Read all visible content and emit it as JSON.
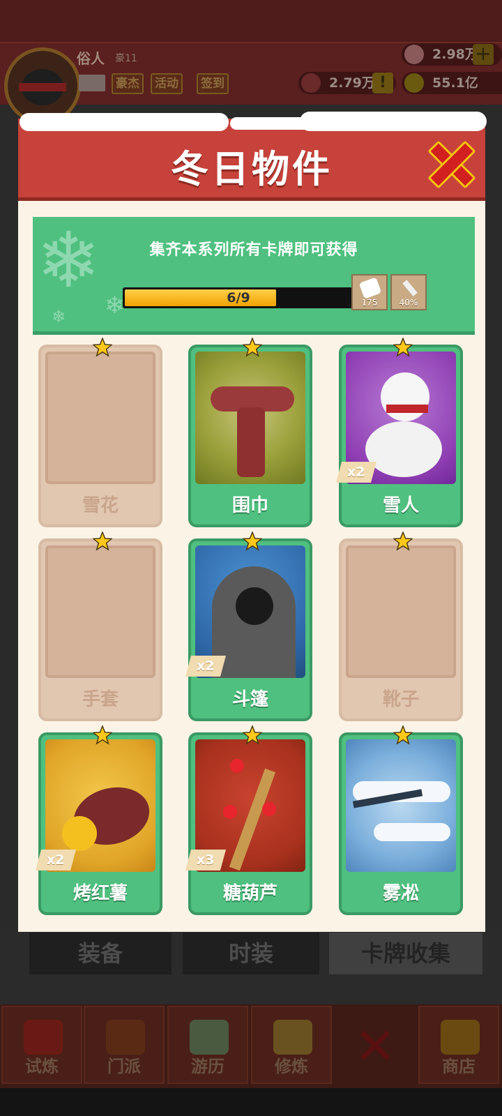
{
  "hud": {
    "player_name": "俗人",
    "player_level": "豪11",
    "buttons": [
      "豪杰",
      "活动",
      "签到"
    ],
    "gems": "2.98万",
    "tokens": "2.79万",
    "coins": "55.1亿",
    "plus": "+",
    "warn": "!"
  },
  "tabs": [
    "装备",
    "时装",
    "卡牌收集"
  ],
  "nav": [
    "试炼",
    "门派",
    "游历",
    "修炼",
    "",
    "商店"
  ],
  "modal": {
    "title": "冬日物件",
    "close_symbol": "✕",
    "banner_text": "集齐本系列所有卡牌即可获得",
    "progress_text": "6/9",
    "progress": 0.667,
    "rewards": [
      {
        "icon": "dice-icon",
        "value": "175"
      },
      {
        "icon": "sword-icon",
        "value": "40%"
      }
    ]
  },
  "cards": [
    {
      "name": "雪花",
      "owned": false,
      "count": ""
    },
    {
      "name": "围巾",
      "owned": true,
      "count": ""
    },
    {
      "name": "雪人",
      "owned": true,
      "count": "x2"
    },
    {
      "name": "手套",
      "owned": false,
      "count": ""
    },
    {
      "name": "斗篷",
      "owned": true,
      "count": "x2"
    },
    {
      "name": "靴子",
      "owned": false,
      "count": ""
    },
    {
      "name": "烤红薯",
      "owned": true,
      "count": "x2"
    },
    {
      "name": "糖葫芦",
      "owned": true,
      "count": "x3"
    },
    {
      "name": "雾凇",
      "owned": true,
      "count": ""
    }
  ],
  "colors": {
    "header_red": "#c6423a",
    "banner_green": "#4fc07f",
    "card_green": "#4fc07f",
    "locked_card": "#e1c6b0",
    "progress_gold": "#f0a100",
    "close_red": "#d21f1f"
  }
}
